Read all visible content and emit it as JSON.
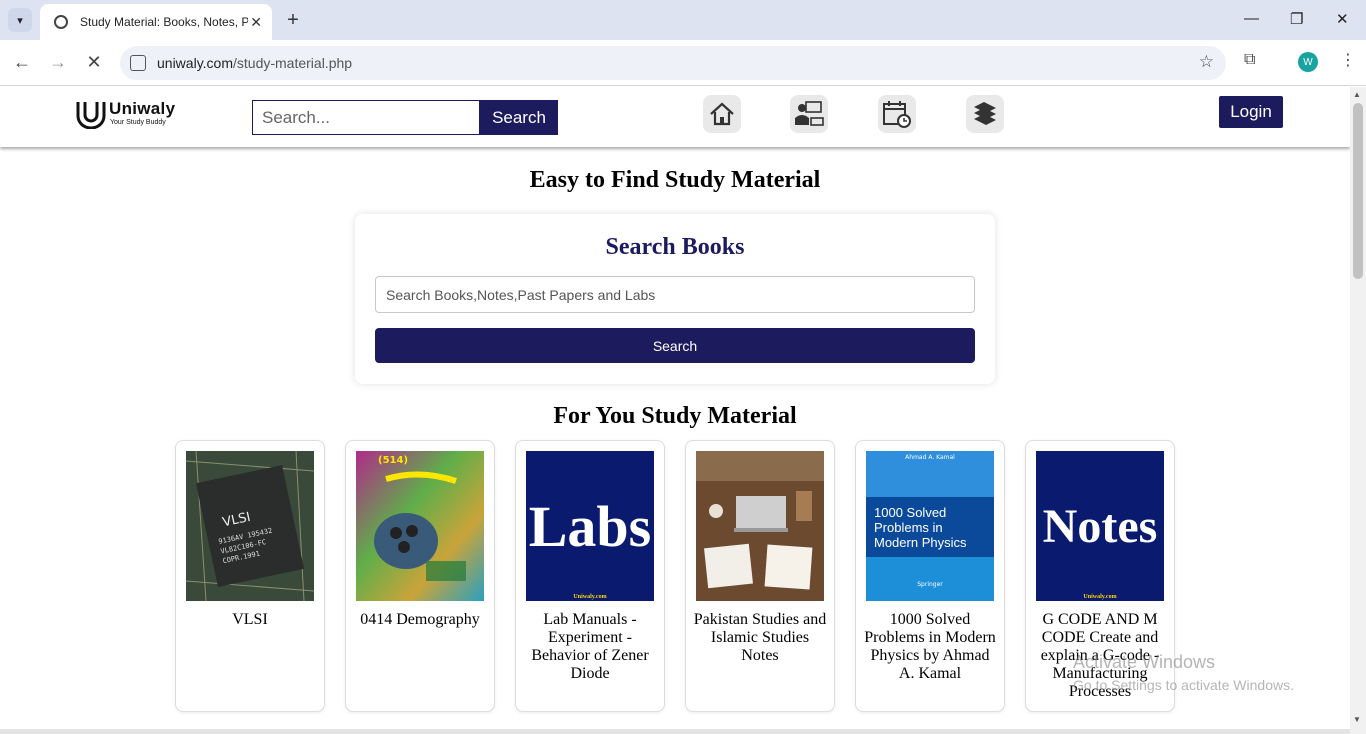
{
  "browser": {
    "tab_title": "Study Material: Books, Notes, P",
    "url_host": "uniwaly.com",
    "url_path": "/study-material.php",
    "profile_initial": "W"
  },
  "site": {
    "logo_name": "Uniwaly",
    "logo_tagline": "Your Study Buddy",
    "header_search_placeholder": "Search...",
    "header_search_button": "Search",
    "nav_icons": [
      "home-icon",
      "teacher-icon",
      "schedule-icon",
      "books-icon"
    ],
    "login_button": "Login",
    "brand_color": "#1b1b5e"
  },
  "main": {
    "heading": "Easy to Find Study Material",
    "search_card": {
      "title": "Search Books",
      "input_placeholder": "Search Books,Notes,Past Papers and Labs",
      "button": "Search"
    },
    "for_you_heading": "For You Study Material",
    "items": [
      {
        "title": "VLSI",
        "thumb": "chip-image"
      },
      {
        "title": "0414 Demography",
        "thumb": "urdu-book-cover"
      },
      {
        "title": "Lab Manuals - Experiment - Behavior of Zener Diode",
        "thumb_text": "Labs",
        "thumb_wm": "Uniwaly.com"
      },
      {
        "title": "Pakistan Studies and Islamic Studies Notes",
        "thumb": "desk-photo"
      },
      {
        "title": "1000 Solved Problems in Modern Physics by Ahmad A. Kamal",
        "thumb_lines": [
          "1000 Solved",
          "Problems in",
          "Modern Physics"
        ],
        "thumb_author": "Ahmad A. Kamal",
        "thumb_publisher": "Springer"
      },
      {
        "title": "G CODE AND M CODE Create and explain a G-code - Manufacturing Processes",
        "thumb_text": "Notes",
        "thumb_wm": "Uniwaly.com"
      }
    ]
  },
  "os_watermark": {
    "line1": "Activate Windows",
    "line2": "Go to Settings to activate Windows."
  }
}
